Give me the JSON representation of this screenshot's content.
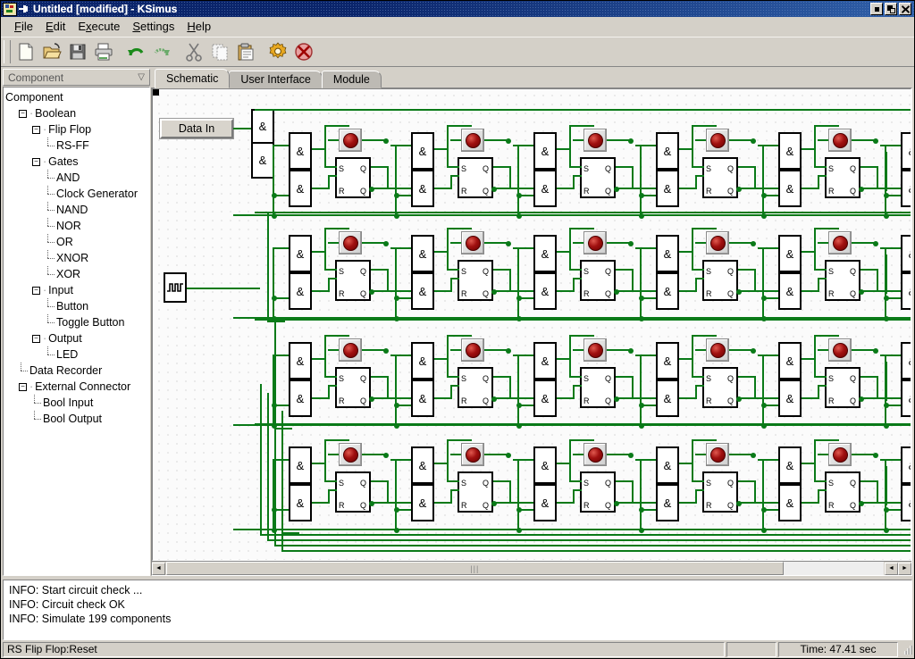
{
  "window": {
    "title": "Untitled [modified] - KSimus",
    "icon": "app-icon",
    "buttons": {
      "minimize": "▪",
      "maximize": "❐",
      "close": "✖"
    }
  },
  "menu": {
    "items": [
      {
        "label": "File"
      },
      {
        "label": "Edit"
      },
      {
        "label": "Execute"
      },
      {
        "label": "Settings"
      },
      {
        "label": "Help"
      }
    ]
  },
  "toolbar": {
    "buttons": [
      {
        "name": "new-icon",
        "title": "New"
      },
      {
        "name": "open-icon",
        "title": "Open"
      },
      {
        "name": "save-icon",
        "title": "Save"
      },
      {
        "name": "print-icon",
        "title": "Print"
      },
      {
        "name": "undo-icon",
        "title": "Undo"
      },
      {
        "name": "redo-icon",
        "title": "Redo"
      },
      {
        "name": "cut-icon",
        "title": "Cut"
      },
      {
        "name": "copy-icon",
        "title": "Copy"
      },
      {
        "name": "paste-icon",
        "title": "Paste"
      },
      {
        "name": "gear-icon",
        "title": "Execute"
      },
      {
        "name": "stop-icon",
        "title": "Stop"
      }
    ]
  },
  "sidebar": {
    "header": {
      "label": "Component",
      "sort_arrow": "▽"
    },
    "tree": [
      {
        "label": "Component",
        "depth": 0,
        "toggle": "none"
      },
      {
        "label": "Boolean",
        "depth": 1,
        "toggle": "minus"
      },
      {
        "label": "Flip Flop",
        "depth": 2,
        "toggle": "minus"
      },
      {
        "label": "RS-FF",
        "depth": 3,
        "toggle": "leaf"
      },
      {
        "label": "Gates",
        "depth": 2,
        "toggle": "minus"
      },
      {
        "label": "AND",
        "depth": 3,
        "toggle": "leaf"
      },
      {
        "label": "Clock Generator",
        "depth": 3,
        "toggle": "leaf"
      },
      {
        "label": "NAND",
        "depth": 3,
        "toggle": "leaf"
      },
      {
        "label": "NOR",
        "depth": 3,
        "toggle": "leaf"
      },
      {
        "label": "OR",
        "depth": 3,
        "toggle": "leaf"
      },
      {
        "label": "XNOR",
        "depth": 3,
        "toggle": "leaf"
      },
      {
        "label": "XOR",
        "depth": 3,
        "toggle": "leaf"
      },
      {
        "label": "Input",
        "depth": 2,
        "toggle": "minus"
      },
      {
        "label": "Button",
        "depth": 3,
        "toggle": "leaf"
      },
      {
        "label": "Toggle Button",
        "depth": 3,
        "toggle": "leaf"
      },
      {
        "label": "Output",
        "depth": 2,
        "toggle": "minus"
      },
      {
        "label": "LED",
        "depth": 3,
        "toggle": "leaf"
      },
      {
        "label": "Data Recorder",
        "depth": 1,
        "toggle": "leaf"
      },
      {
        "label": "External Connector",
        "depth": 1,
        "toggle": "minus"
      },
      {
        "label": "Bool Input",
        "depth": 2,
        "toggle": "leaf"
      },
      {
        "label": "Bool Output",
        "depth": 2,
        "toggle": "leaf"
      }
    ]
  },
  "tabs": [
    {
      "label": "Schematic",
      "active": true
    },
    {
      "label": "User Interface",
      "active": false
    },
    {
      "label": "Module",
      "active": false
    }
  ],
  "schematic": {
    "data_in_button": "Data In",
    "clock_generator_icon": "clock-waveform-icon",
    "gate_symbol": "&",
    "flipflop_labels": {
      "s": "S",
      "q_top": "Q",
      "r": "R",
      "q_bottom": "Q"
    },
    "led_color": "#a01010",
    "wire_color": "#0a7a18",
    "rows": 4,
    "cells_per_row": 7,
    "component_count": 199
  },
  "scrollbars": {
    "horizontal": {
      "left_arrow": "◄",
      "right_arrow": "►",
      "grip": "|||",
      "thumb_percent": 86
    }
  },
  "log": {
    "lines": [
      "INFO: Start circuit check ...",
      "INFO: Circuit check OK",
      "INFO: Simulate 199 components"
    ]
  },
  "status": {
    "message": "RS Flip Flop:Reset",
    "time": "Time: 47.41 sec"
  }
}
